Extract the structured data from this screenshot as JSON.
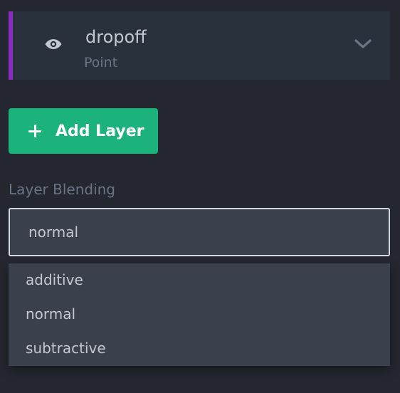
{
  "layer": {
    "name": "dropoff",
    "type": "Point",
    "accent_color": "#8a2dbf",
    "visibility_icon": "eye-icon",
    "expand_icon": "chevron-down-icon"
  },
  "add_layer_button": {
    "label": "Add Layer",
    "icon": "plus-icon",
    "color": "#1bb27c"
  },
  "layer_blending": {
    "label": "Layer Blending",
    "selected": "normal",
    "options": [
      "additive",
      "normal",
      "subtractive"
    ]
  }
}
